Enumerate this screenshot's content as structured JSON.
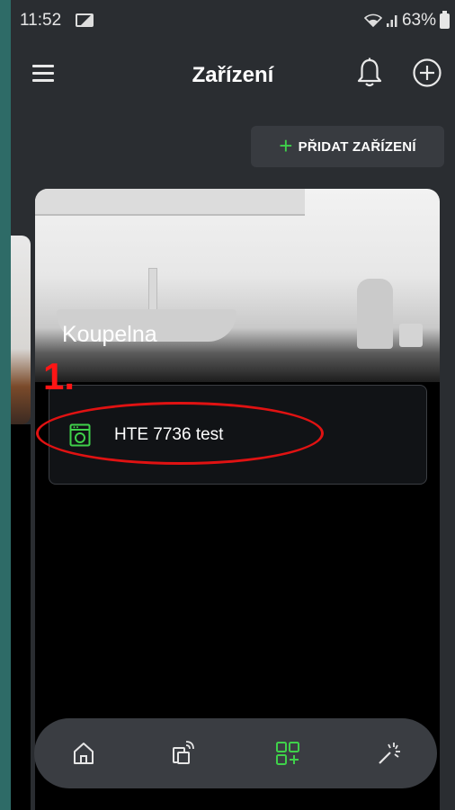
{
  "status_bar": {
    "time": "11:52",
    "battery": "63%"
  },
  "header": {
    "title": "Zařízení",
    "menu_icon": "hamburger-menu-icon",
    "bell_icon": "bell-icon",
    "add_icon": "plus-circle-icon"
  },
  "toolbar": {
    "add_device_label": "PŘIDAT ZAŘÍZENÍ",
    "add_device_icon": "+"
  },
  "room": {
    "title": "Koupelna",
    "devices": [
      {
        "name": "HTE 7736 test",
        "icon": "washing-machine-icon"
      }
    ]
  },
  "annotation": {
    "label": "1."
  },
  "bottom_nav": {
    "items": [
      {
        "icon": "home-icon",
        "active": false
      },
      {
        "icon": "remote-devices-icon",
        "active": false
      },
      {
        "icon": "devices-grid-add-icon",
        "active": true
      },
      {
        "icon": "magic-wand-icon",
        "active": false
      }
    ]
  },
  "colors": {
    "accent_green": "#3fd14a",
    "annotation_red": "#e01212",
    "background": "#2a2d31"
  }
}
